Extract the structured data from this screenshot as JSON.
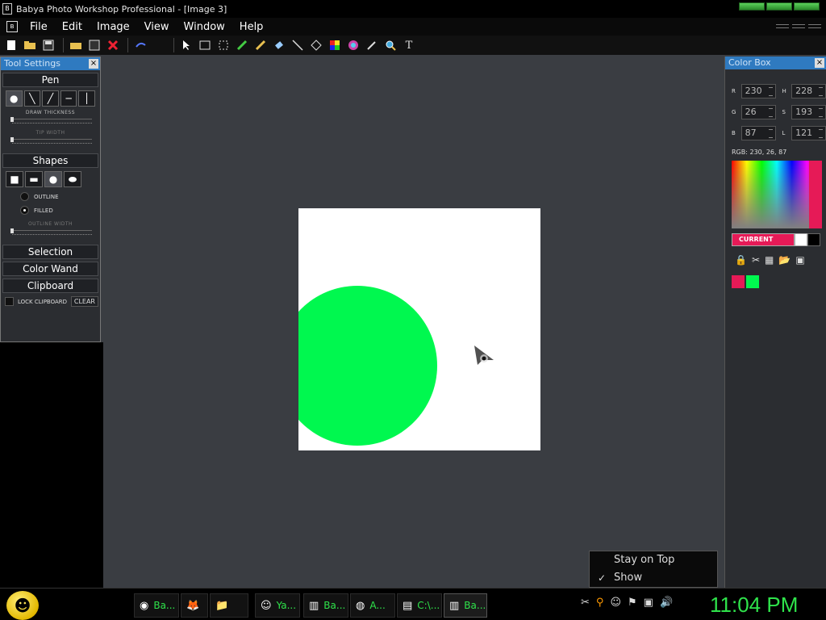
{
  "window": {
    "title": "Babya Photo Workshop Professional - [Image  3]"
  },
  "menu": [
    "File",
    "Edit",
    "Image",
    "View",
    "Window",
    "Help"
  ],
  "toolbar": {
    "icons": [
      "new-icon",
      "open-icon",
      "save-icon",
      "open-folder-icon",
      "save-as-icon",
      "delete-icon",
      "undo-icon",
      "pointer-icon",
      "rect-select-icon",
      "lasso-icon",
      "pen-icon",
      "brush-icon",
      "eraser-icon",
      "line-icon",
      "fill-icon",
      "color-picker-icon",
      "color-wheel-icon",
      "eyedropper-icon",
      "zoom-icon",
      "text-icon"
    ],
    "text_tool": "T"
  },
  "tool_settings": {
    "title": "Tool Settings",
    "close": "×",
    "pen_label": "Pen",
    "draw_thickness_label": "DRAW THICKNESS",
    "tip_width_label": "TIP WIDTH",
    "shapes_label": "Shapes",
    "outline_label": "OUTLINE",
    "filled_label": "FILLED",
    "outline_width_label": "OUTLINE WIDTH",
    "selection_label": "Selection",
    "color_wand_label": "Color Wand",
    "clipboard_label": "Clipboard",
    "lock_clipboard_label": "LOCK CLIPBOARD",
    "clear_label": "CLEAR"
  },
  "color_box": {
    "title": "Color Box",
    "close": "×",
    "r_label": "R",
    "r_value": "230",
    "g_label": "G",
    "g_value": "26",
    "b_label": "B",
    "b_value": "87",
    "h_label": "H",
    "h_value": "228",
    "s_label": "S",
    "s_value": "193",
    "l_label": "L",
    "l_value": "121",
    "rgb_text": "RGB: 230, 26, 87",
    "current_label": "CURRENT",
    "current_color": "#e61a57",
    "swatches": [
      "#e61a57",
      "#00f84f"
    ]
  },
  "canvas": {
    "circle_color": "#00f84f",
    "background": "#ffffff"
  },
  "popup": {
    "stay_on_top": "Stay on Top",
    "show": "Show",
    "check": "✓"
  },
  "taskbar": {
    "buttons": [
      "Ba...",
      "Ya...",
      "Ba...",
      "A...",
      "C:\\...",
      "Ba..."
    ],
    "clock": "11:04 PM"
  }
}
